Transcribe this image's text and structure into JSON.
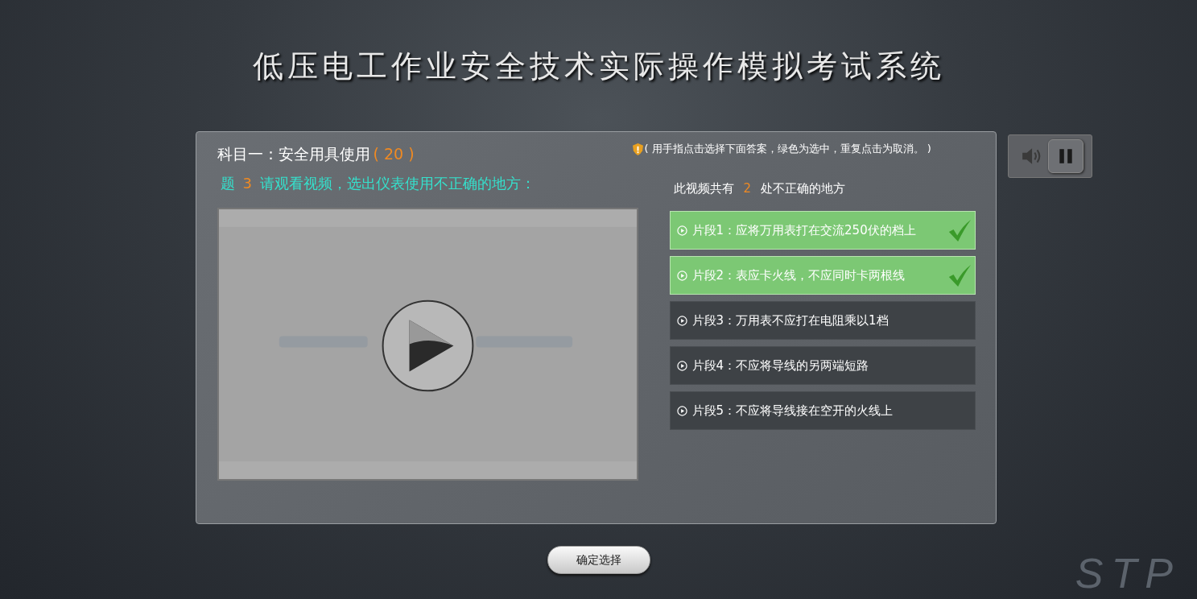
{
  "title": "低压电工作业安全技术实际操作模拟考试系统",
  "subject": {
    "label": "科目一：安全用具使用",
    "score": "( 20 )"
  },
  "question": {
    "prefix": "题",
    "number": "3",
    "text": "请观看视频，选出仪表使用不正确的地方："
  },
  "hint": "( 用手指点击选择下面答案，绿色为选中，重复点击为取消。 )",
  "count_line": {
    "before": "此视频共有",
    "count": "2",
    "after": "处不正确的地方"
  },
  "options": [
    {
      "label": "片段1：应将万用表打在交流250伏的档上",
      "selected": true
    },
    {
      "label": "片段2：表应卡火线，不应同时卡两根线",
      "selected": true
    },
    {
      "label": "片段3：万用表不应打在电阻乘以1档",
      "selected": false
    },
    {
      "label": "片段4：不应将导线的另两端短路",
      "selected": false
    },
    {
      "label": "片段5：不应将导线接在空开的火线上",
      "selected": false
    }
  ],
  "confirm_button": "确定选择",
  "logo": "STP"
}
